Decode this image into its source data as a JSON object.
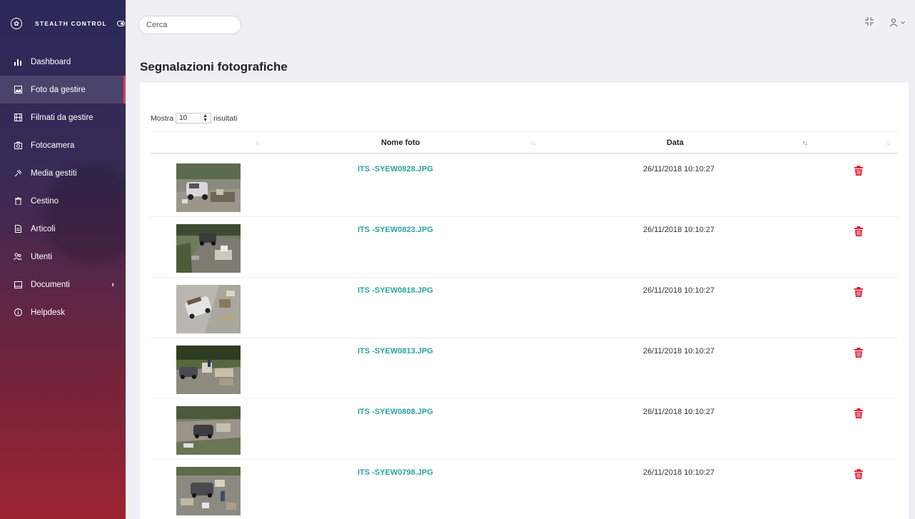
{
  "brand": {
    "name": "STEALTH CONTROL"
  },
  "sidebar": {
    "items": [
      {
        "label": "Dashboard",
        "icon": "bar-chart-icon"
      },
      {
        "label": "Foto da gestire",
        "icon": "image-icon"
      },
      {
        "label": "Filmati da gestire",
        "icon": "film-icon"
      },
      {
        "label": "Fotocamera",
        "icon": "camera-icon"
      },
      {
        "label": "Media gestiti",
        "icon": "pin-icon"
      },
      {
        "label": "Cestino",
        "icon": "trash-icon"
      },
      {
        "label": "Articoli",
        "icon": "document-icon"
      },
      {
        "label": "Utenti",
        "icon": "users-icon"
      },
      {
        "label": "Documenti",
        "icon": "folder-icon"
      },
      {
        "label": "Helpdesk",
        "icon": "info-icon"
      }
    ]
  },
  "search": {
    "placeholder": "Cerca"
  },
  "page": {
    "title": "Segnalazioni fotografiche"
  },
  "table": {
    "length_prefix": "Mostra",
    "length_value": "10",
    "length_suffix": "risultati",
    "headers": {
      "name": "Nome foto",
      "date": "Data"
    },
    "rows": [
      {
        "name": "ITS -SYEW0828.JPG",
        "date": "26/11/2018 10:10:27"
      },
      {
        "name": "ITS -SYEW0823.JPG",
        "date": "26/11/2018 10:10:27"
      },
      {
        "name": "ITS -SYEW0818.JPG",
        "date": "26/11/2018 10:10:27"
      },
      {
        "name": "ITS -SYEW0813.JPG",
        "date": "26/11/2018 10:10:27"
      },
      {
        "name": "ITS -SYEW0808.JPG",
        "date": "26/11/2018 10:10:27"
      },
      {
        "name": "ITS -SYEW0798.JPG",
        "date": "26/11/2018 10:10:27"
      }
    ]
  },
  "colors": {
    "accent": "#2aa2a0",
    "danger": "#e0203a",
    "active_marker": "#e8385d"
  }
}
